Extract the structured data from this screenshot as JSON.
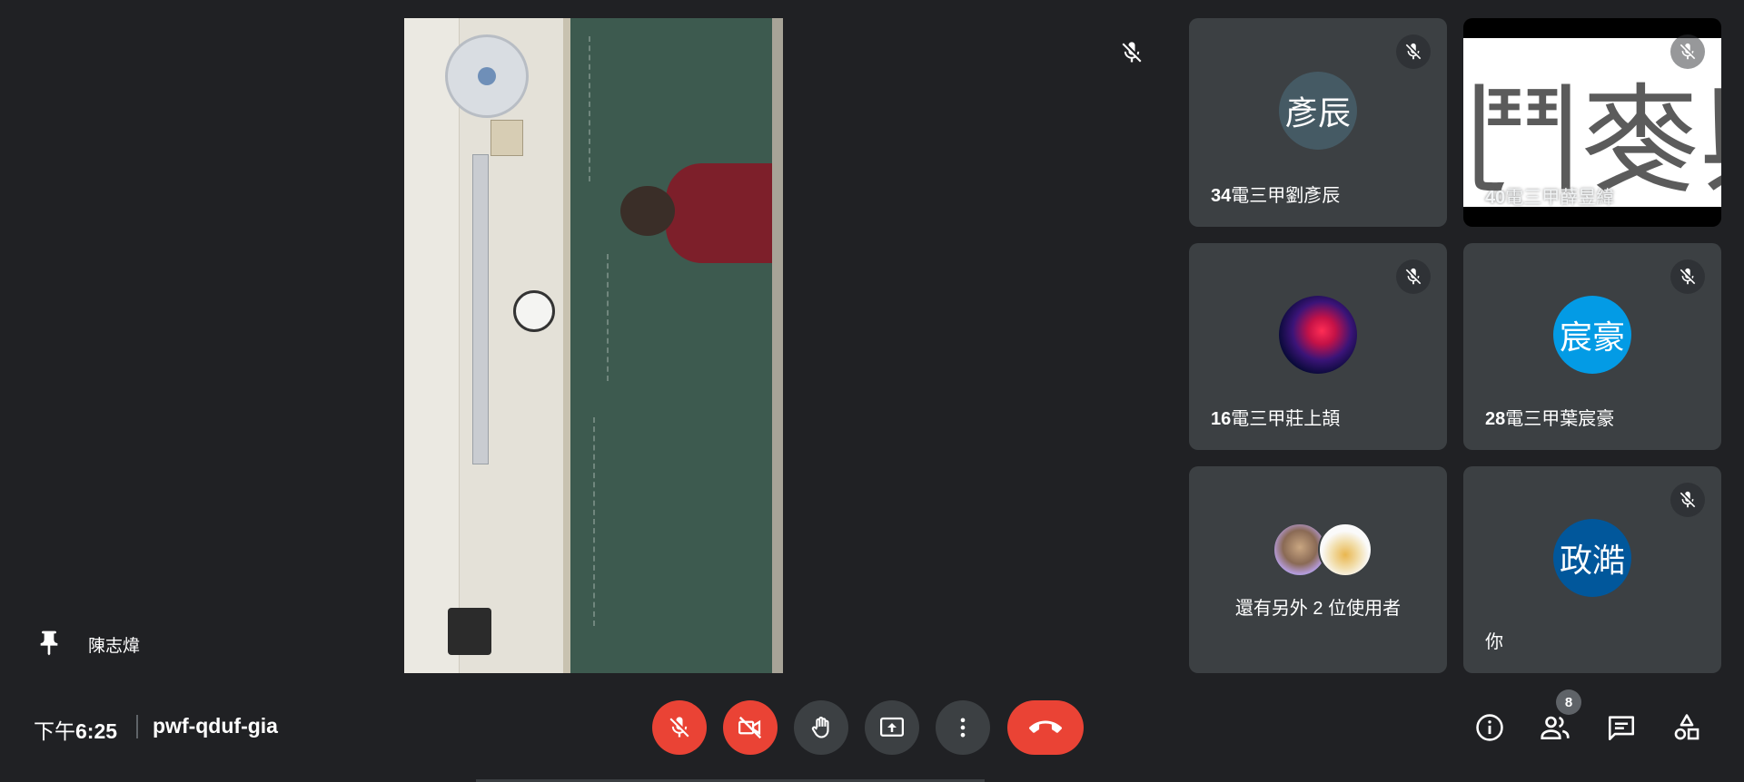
{
  "stage": {
    "pinned_name": "陳志煒",
    "mic_muted": true
  },
  "tiles": [
    {
      "avatar_text": "彥辰",
      "name_prefix": "34",
      "name": "電三甲劉彥辰",
      "avatar_color": "#455a64",
      "mic_muted": true
    },
    {
      "name_prefix": "40",
      "name": "電三甲薛昱緯",
      "screen_text": "與麥鬥",
      "mic_muted": true
    },
    {
      "name_prefix": "16",
      "name": "電三甲莊上頡",
      "mic_muted": true
    },
    {
      "avatar_text": "宸豪",
      "name_prefix": "28",
      "name": "電三甲葉宸豪",
      "avatar_color": "#039be5",
      "mic_muted": true
    },
    {
      "more_label": "還有另外 2 位使用者"
    },
    {
      "avatar_text": "政澔",
      "name": "你",
      "avatar_color": "#01579b",
      "mic_muted": true
    }
  ],
  "bottom_bar": {
    "time_prefix": "下午",
    "time": "6:25",
    "meeting_code": "pwf-qduf-gia",
    "people_count": "8"
  },
  "controls": {
    "mic": "mic-off-icon",
    "camera": "videocam-off-icon",
    "raise_hand": "hand-icon",
    "present": "present-screen-icon",
    "more": "more-vert-icon",
    "leave": "call-end-icon",
    "accent_red": "#ea4335",
    "button_gray": "#3c4043"
  },
  "side_controls": [
    "info-icon",
    "people-icon",
    "chat-icon",
    "activities-icon"
  ]
}
